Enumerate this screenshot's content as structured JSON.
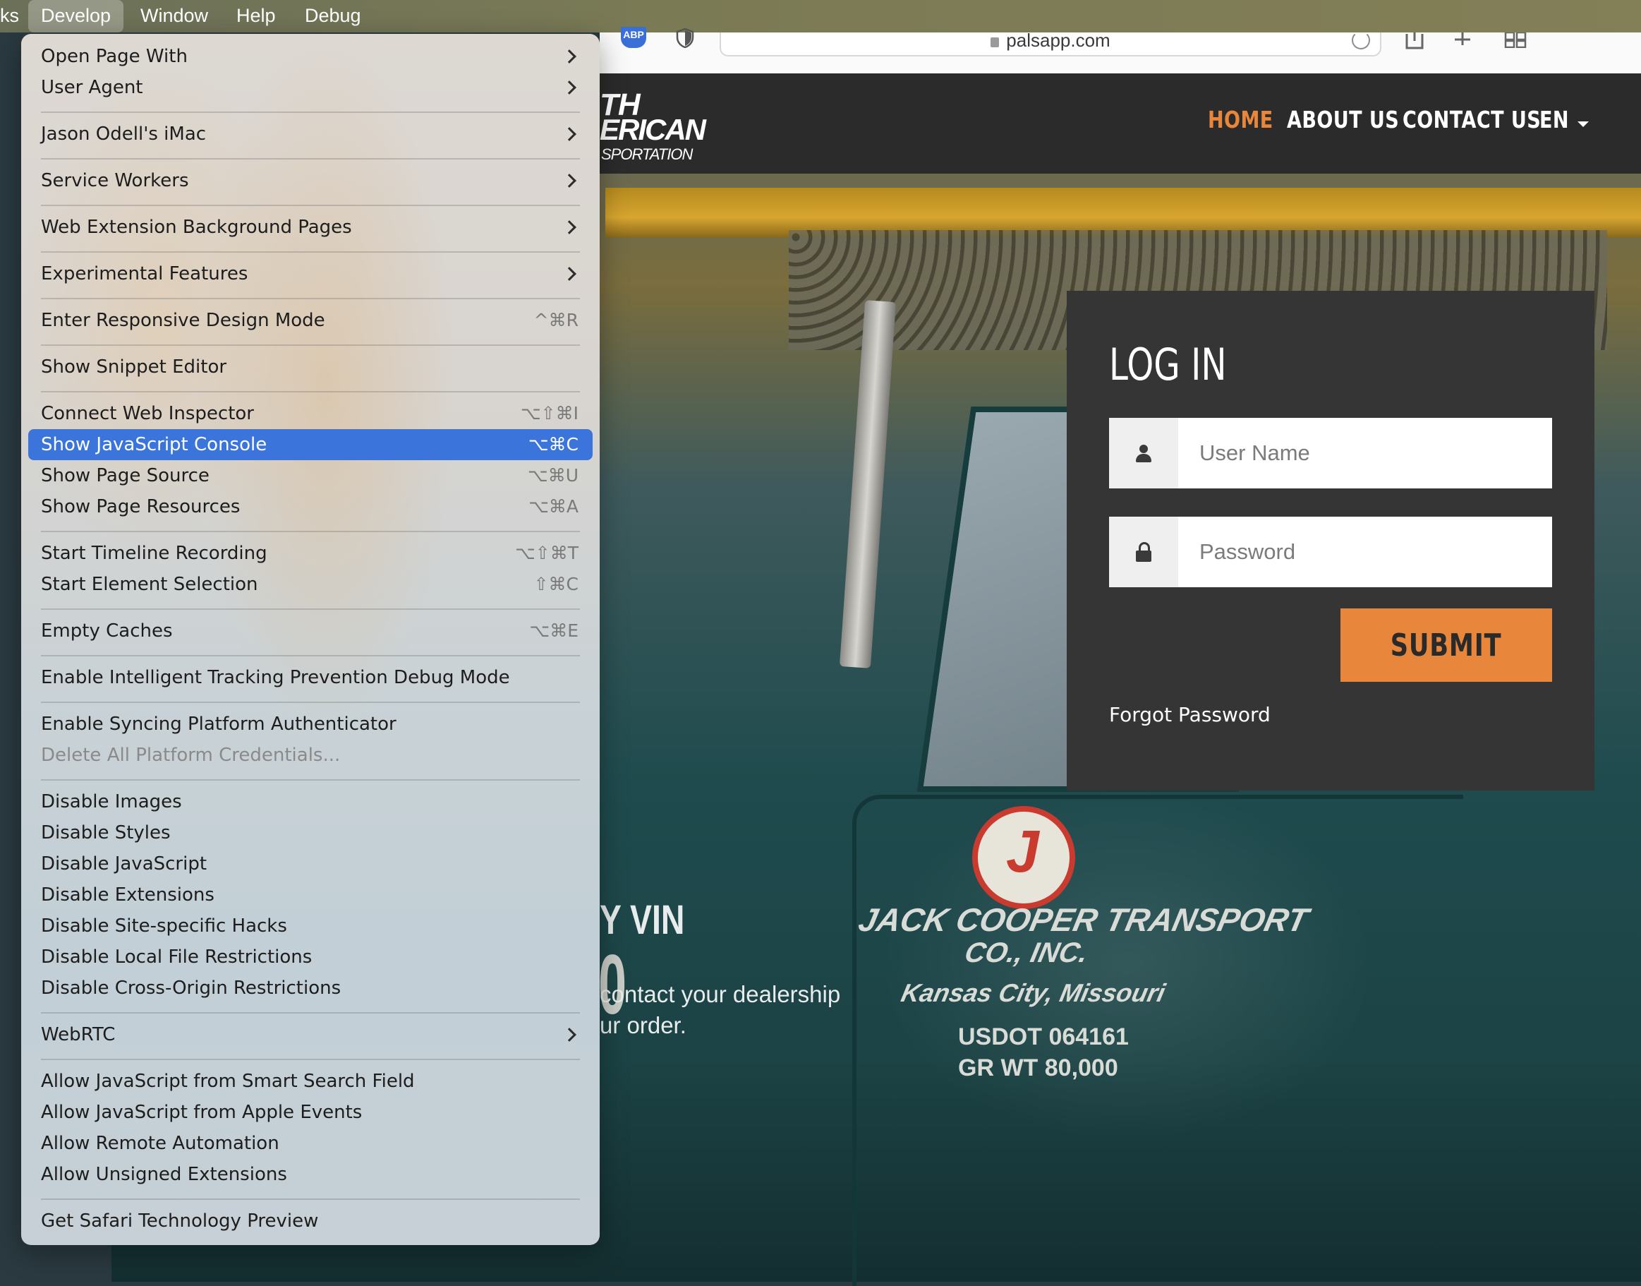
{
  "menubar": {
    "left_fragment": "ks",
    "items": [
      "Develop",
      "Window",
      "Help",
      "Debug"
    ],
    "active": "Develop"
  },
  "browser": {
    "url": "palsapp.com",
    "extension_label": "ABP"
  },
  "site": {
    "logo_lines": [
      "TH",
      "ERICAN",
      "SPORTATION"
    ],
    "nav": [
      "HOME",
      "ABOUT US",
      "CONTACT US",
      "EN"
    ],
    "nav_active": "HOME",
    "hero_heading_fragment": "Y VIN",
    "hero_text_lines": [
      "contact your dealership",
      "ur order."
    ],
    "truck_text": [
      "JACK COOPER TRANSPORT",
      "CO., INC.",
      "Kansas City, Missouri",
      "USDOT 064161",
      "GR WT 80,000"
    ],
    "truck_badge": "J",
    "truck_fragment": "0",
    "login": {
      "title": "LOG IN",
      "username_placeholder": "User Name",
      "password_placeholder": "Password",
      "submit": "SUBMIT",
      "forgot": "Forgot Password"
    },
    "accent_color": "#e8873c"
  },
  "develop_menu": {
    "highlight_color": "#3b74db",
    "items": [
      {
        "label": "Open Page With",
        "submenu": true
      },
      {
        "label": "User Agent",
        "submenu": true
      },
      {
        "label": "Jason Odell's iMac",
        "submenu": true
      },
      {
        "label": "Service Workers",
        "submenu": true
      },
      {
        "label": "Web Extension Background Pages",
        "submenu": true
      },
      {
        "label": "Experimental Features",
        "submenu": true
      },
      {
        "label": "Enter Responsive Design Mode",
        "shortcut": "^⌘R"
      },
      {
        "label": "Show Snippet Editor"
      },
      {
        "label": "Connect Web Inspector",
        "shortcut": "⌥⇧⌘I"
      },
      {
        "label": "Show JavaScript Console",
        "shortcut": "⌥⌘C",
        "highlighted": true
      },
      {
        "label": "Show Page Source",
        "shortcut": "⌥⌘U"
      },
      {
        "label": "Show Page Resources",
        "shortcut": "⌥⌘A"
      },
      {
        "label": "Start Timeline Recording",
        "shortcut": "⌥⇧⌘T"
      },
      {
        "label": "Start Element Selection",
        "shortcut": "⇧⌘C"
      },
      {
        "label": "Empty Caches",
        "shortcut": "⌥⌘E"
      },
      {
        "label": "Enable Intelligent Tracking Prevention Debug Mode"
      },
      {
        "label": "Enable Syncing Platform Authenticator"
      },
      {
        "label": "Delete All Platform Credentials...",
        "disabled": true
      },
      {
        "label": "Disable Images"
      },
      {
        "label": "Disable Styles"
      },
      {
        "label": "Disable JavaScript"
      },
      {
        "label": "Disable Extensions"
      },
      {
        "label": "Disable Site-specific Hacks"
      },
      {
        "label": "Disable Local File Restrictions"
      },
      {
        "label": "Disable Cross-Origin Restrictions"
      },
      {
        "label": "WebRTC",
        "submenu": true
      },
      {
        "label": "Allow JavaScript from Smart Search Field"
      },
      {
        "label": "Allow JavaScript from Apple Events"
      },
      {
        "label": "Allow Remote Automation"
      },
      {
        "label": "Allow Unsigned Extensions"
      },
      {
        "label": "Get Safari Technology Preview"
      }
    ]
  }
}
